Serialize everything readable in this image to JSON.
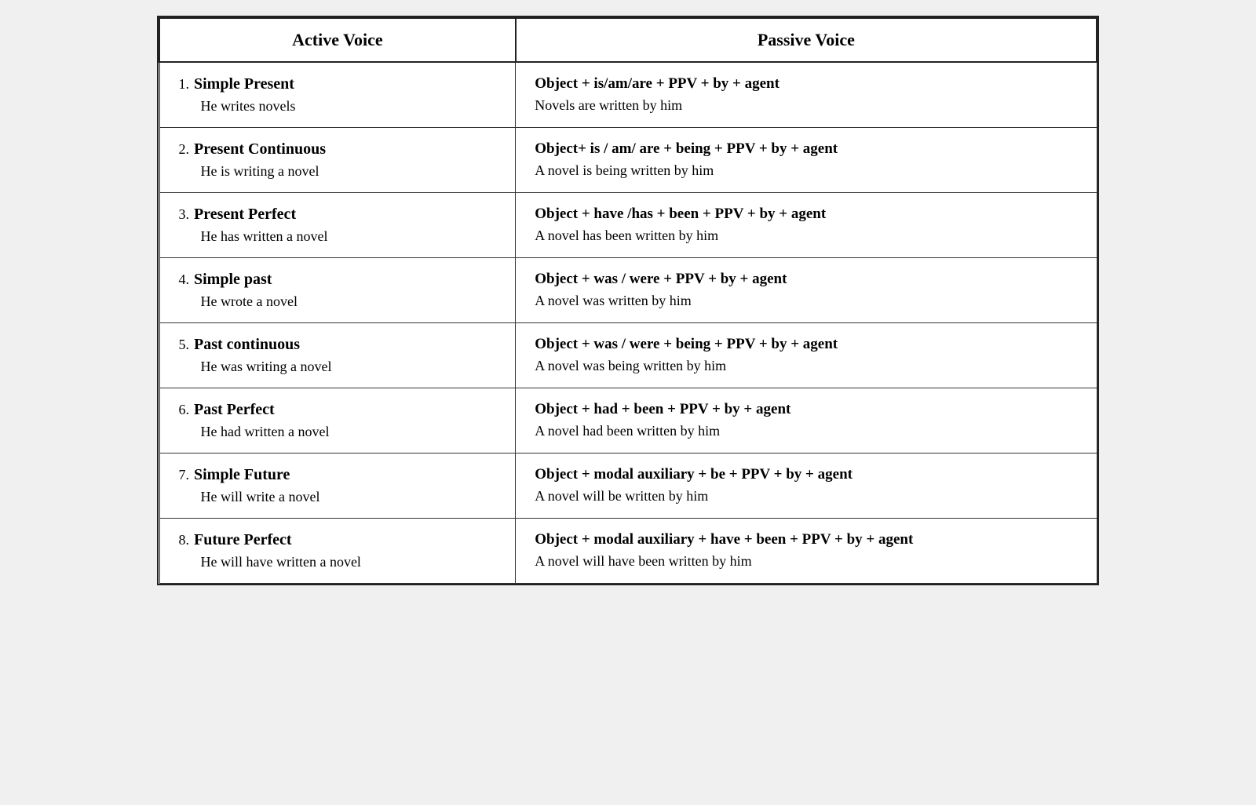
{
  "headers": {
    "active": "Active Voice",
    "passive": "Passive Voice"
  },
  "rows": [
    {
      "number": "1.",
      "tense": "Simple Present",
      "active_example": "He writes novels",
      "passive_formula": "Object + is/am/are + PPV + by + agent",
      "passive_example": "Novels are written by him"
    },
    {
      "number": "2.",
      "tense": "Present Continuous",
      "active_example": "He is writing a novel",
      "passive_formula": "Object+ is / am/ are + being + PPV + by + agent",
      "passive_example": "A novel is being written by him"
    },
    {
      "number": "3.",
      "tense": "Present Perfect",
      "active_example": "He has written a novel",
      "passive_formula": "Object + have /has + been + PPV + by + agent",
      "passive_example": "A novel has been written by him"
    },
    {
      "number": "4.",
      "tense": "Simple past",
      "active_example": "He wrote a novel",
      "passive_formula": "Object + was / were + PPV + by + agent",
      "passive_example": "A novel was written by him"
    },
    {
      "number": "5.",
      "tense": "Past continuous",
      "active_example": "He was writing a novel",
      "passive_formula": "Object + was / were + being + PPV + by + agent",
      "passive_example": "A novel was  being written by him"
    },
    {
      "number": "6.",
      "tense": "Past Perfect",
      "active_example": "He had written a novel",
      "passive_formula": "Object + had + been + PPV + by + agent",
      "passive_example": "A novel had been written by him"
    },
    {
      "number": "7.",
      "tense": "Simple Future",
      "active_example": "He will write a novel",
      "passive_formula": "Object + modal auxiliary + be + PPV + by + agent",
      "passive_example": "A novel will be written by him"
    },
    {
      "number": "8.",
      "tense": "Future Perfect",
      "active_example": "He will have written a novel",
      "passive_formula": "Object + modal auxiliary +  have + been + PPV + by + agent",
      "passive_example": "A novel will have been written by him"
    }
  ]
}
